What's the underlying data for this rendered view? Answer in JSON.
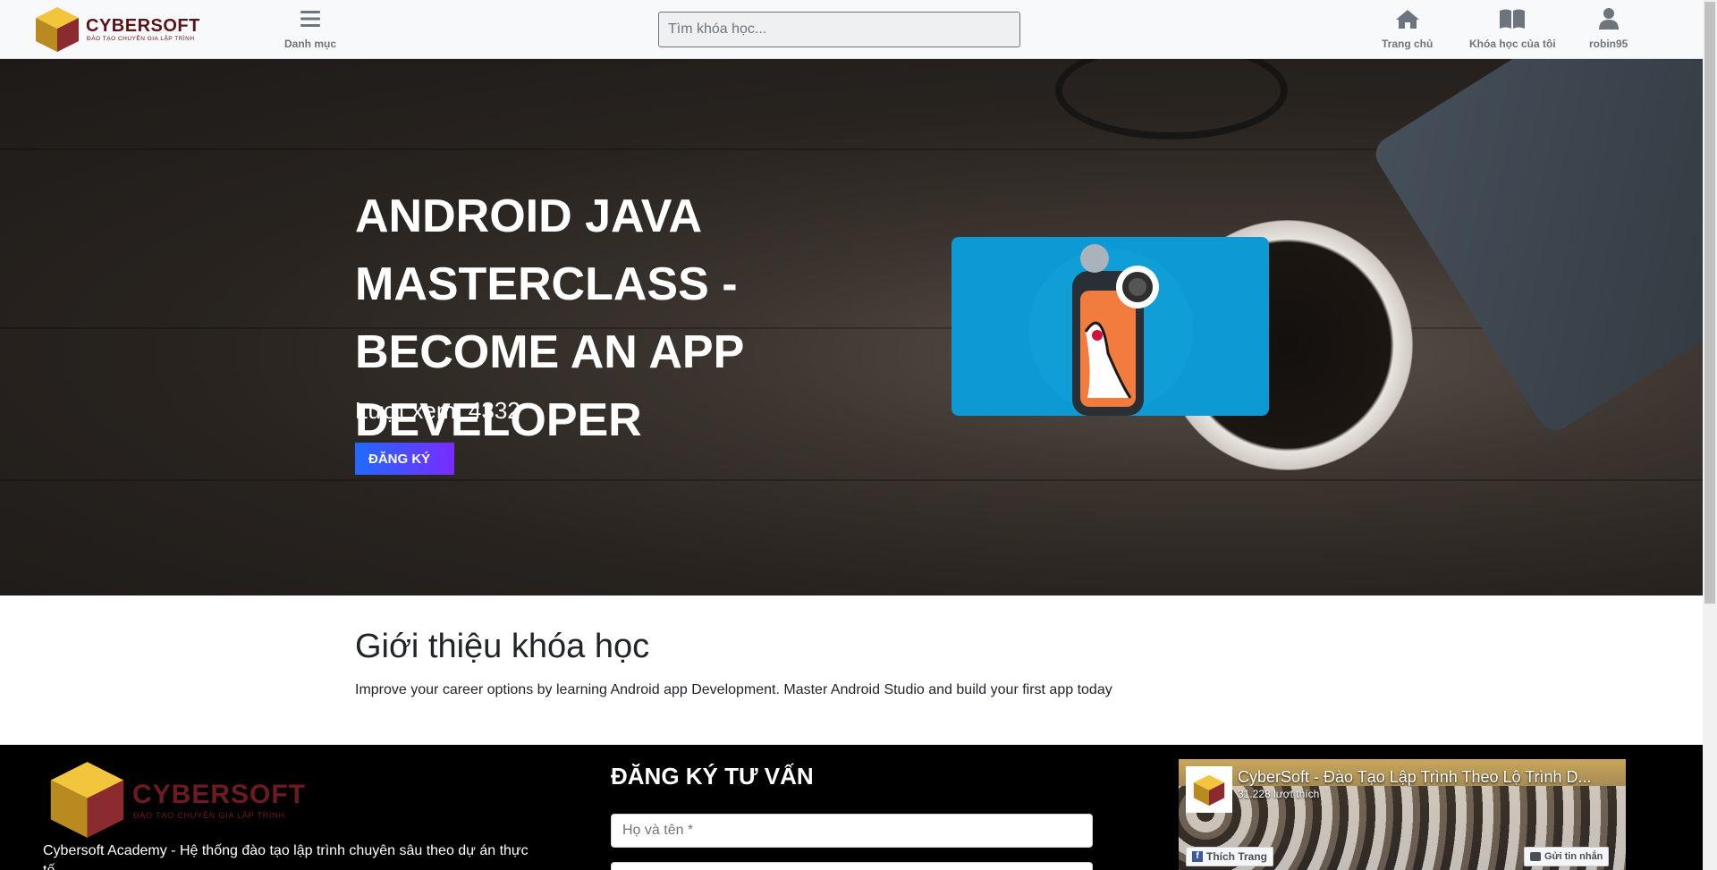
{
  "header": {
    "logo": {
      "name": "CYBERSOFT",
      "tagline": "ĐÀO TẠO CHUYÊN GIA LẬP TRÌNH"
    },
    "menu_label": "Danh mục",
    "search_placeholder": "Tìm khóa học...",
    "nav": {
      "home": "Trang chủ",
      "my_courses": "Khóa học của tôi",
      "user": "robin95"
    }
  },
  "hero": {
    "title": "ANDROID JAVA MASTERCLASS - BECOME AN APP DEVELOPER",
    "views": "Lượt xem: 4332",
    "register_label": "ĐĂNG KÝ"
  },
  "intro": {
    "title": "Giới thiệu khóa học",
    "description": "Improve your career options by learning Android app Development. Master Android Studio and build your first app today"
  },
  "footer": {
    "logo": {
      "name": "CYBERSOFT",
      "tagline": "ĐÀO TẠO CHUYÊN GIA LẬP TRÌNH"
    },
    "description": "Cybersoft Academy - Hệ thống đào tạo lập trình chuyên sâu theo dự án thực tế",
    "consult_title": "ĐĂNG KÝ TƯ VẤN",
    "name_placeholder": "Họ và tên *",
    "facebook": {
      "page_name": "CyberSoft - Đào Tạo Lập Trình Theo Lộ Trình D...",
      "likes": "31.228 lượt thích",
      "like_label": "Thích Trang",
      "message_label": "Gửi tin nhắn"
    }
  },
  "colors": {
    "accent_start": "#1f6bff",
    "accent_end": "#7a2bff",
    "brand": "#5b1218",
    "course_bg": "#0c99d4"
  }
}
